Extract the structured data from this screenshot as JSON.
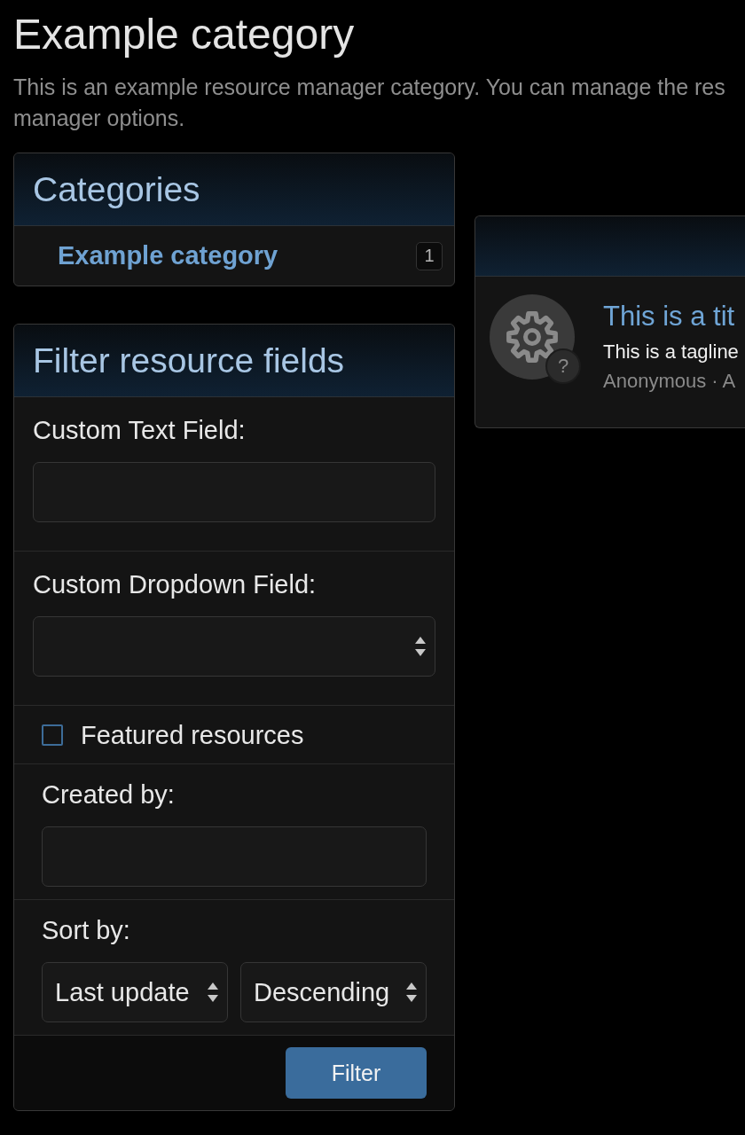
{
  "page": {
    "title": "Example category",
    "description_lines": [
      "This is an example resource manager category. You can manage the res",
      "manager options."
    ]
  },
  "categories": {
    "title": "Categories",
    "items": [
      {
        "label": "Example category",
        "count": "1"
      }
    ]
  },
  "filter": {
    "title": "Filter resource fields",
    "custom_fields": [
      {
        "kind": "text",
        "label": "Custom Text Field:"
      },
      {
        "kind": "select",
        "label": "Custom Dropdown Field:"
      }
    ],
    "standard_fields": [
      {
        "kind": "checkbox",
        "label": "Featured resources",
        "checked": false
      },
      {
        "kind": "text",
        "label": "Created by:"
      },
      {
        "kind": "sort",
        "label": "Sort by:",
        "selects": [
          {
            "value": "Last update"
          },
          {
            "value": "Descending"
          }
        ]
      }
    ],
    "button": "Filter"
  },
  "resource_list": {
    "items": [
      {
        "title": "This is a tit",
        "tagline": "This is a tagline",
        "meta": "Anonymous · A",
        "avatar_badge": "?"
      }
    ]
  }
}
